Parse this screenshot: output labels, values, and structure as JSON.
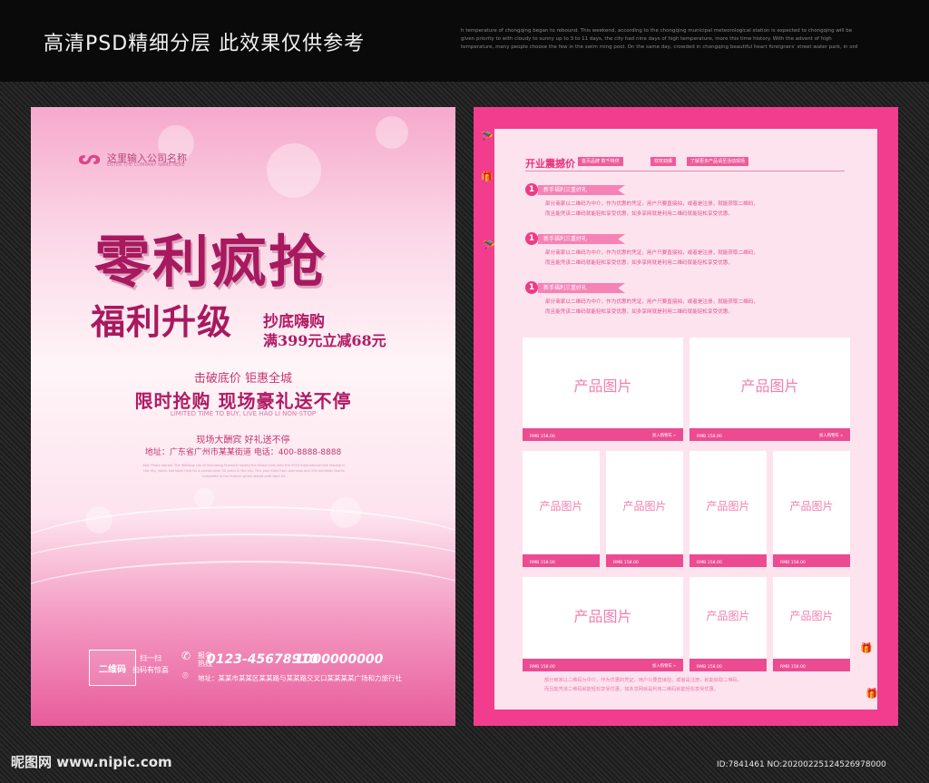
{
  "header": {
    "title": "高清PSD精细分层 此效果仅供参考",
    "english": "h temperature of chongqing began to rebound. This weekend, according to the chongqing municipal meteorological station is expected to chongqing will be given priority to with cloudy to sunny up to 3 to 11 days, the city had nine days of high temperature, more this time history. With the advent of high temperature, many people choose the few in the swim ming pool. On the same day, crowded in chongqing beautiful heart foreigners' street water park, in ord"
  },
  "left_poster": {
    "logo_name": "这里输入公司名称",
    "logo_en": "ENTER THE COMPANY NAME HERE",
    "headline": "零利疯抢",
    "subheadline": "福利升级",
    "promo_line1": "抄底嗨购",
    "promo_line2": "满399元立减68元",
    "slogan1": "击破底价 钜惠全城",
    "slogan2": "限时抢购 现场豪礼送不停",
    "slogan_en": "LIMITED TIME TO BUY, LIVE HAO LI NON-STOP",
    "slogan3": "现场大酬宾 好礼送不停",
    "address_line": "地址：广东省广州市某某街道 电话：400-8888-8888",
    "fine_print": "Add 'Photo stories' The Weifang city of Shandong Province hosted the flower fairs with the 2016 international kite festival in the city, which has been held for a consecutive 33 years in the city. This year kites from overseas and 100 domestic teams competed in the festival which lasted until April 24.",
    "qr_label": "二维码",
    "scan_line1": "扫一扫",
    "scan_line2": "扫码有惊喜",
    "hotline_label": "报名热线",
    "phone1": "0123-45678910",
    "phone2": "1000000000",
    "address": "地址：某某市某某区某某路与某某路交叉口某某某某广场和力旅行社"
  },
  "right_poster": {
    "section_title": "开业震撼价",
    "tags": [
      "首页品牌 数千特供",
      "欢欢劲爆",
      "了解更多产品请至活动现场"
    ],
    "items": [
      {
        "num": "1",
        "ribbon": "新手福利三重好礼",
        "text1": "部分商家以二维码为中介，作为优惠的凭证，用户只要直接拍，或者是注册，就能获取二维码，",
        "text2": "而且能凭该二维码就能轻松享受优惠，如多享网就是利用二维码就能轻松享受优惠。"
      },
      {
        "num": "1",
        "ribbon": "新手福利三重好礼",
        "text1": "部分商家以二维码为中介，作为优惠的凭证，用户只要直接拍，或者是注册，就能获取二维码，",
        "text2": "而且能凭该二维码就能轻松享受优惠，如多享网就是利用二维码就能轻松享受优惠。"
      },
      {
        "num": "1",
        "ribbon": "新手福利三重好礼",
        "text1": "部分商家以二维码为中介，作为优惠的凭证，用户只要直接拍，或者是注册，就能获取二维码，",
        "text2": "而且能凭该二维码就能轻松享受优惠，如多享网就是利用二维码就能轻松享受优惠。"
      }
    ],
    "product_label": "产品图片",
    "price": "RMB 158.00",
    "more": "加入购物车 »",
    "footnote1": "部分商家以二维码为中介，作为优惠的凭证，用户只要直接拍，或者是注册，就能获取二维码，",
    "footnote2": "而且能凭该二维码就能轻松享受优惠，如多享网就是利用二维码就能轻松享受优惠。"
  },
  "watermark": {
    "left": "昵图网 www.nipic.com",
    "right": "ID:7841461 NO:20200225124526978000"
  }
}
